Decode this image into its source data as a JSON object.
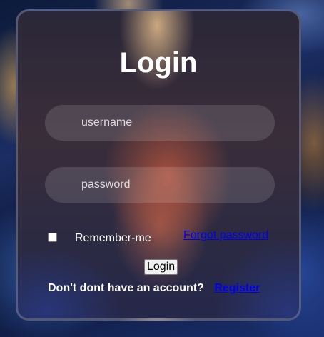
{
  "form": {
    "title": "Login",
    "username_placeholder": "username",
    "password_placeholder": "password",
    "remember_label": "Remember-me",
    "forgot_label": "Forgot password",
    "login_button": "Login",
    "no_account_text": "Don't dont have an account?",
    "register_label": "Register"
  }
}
